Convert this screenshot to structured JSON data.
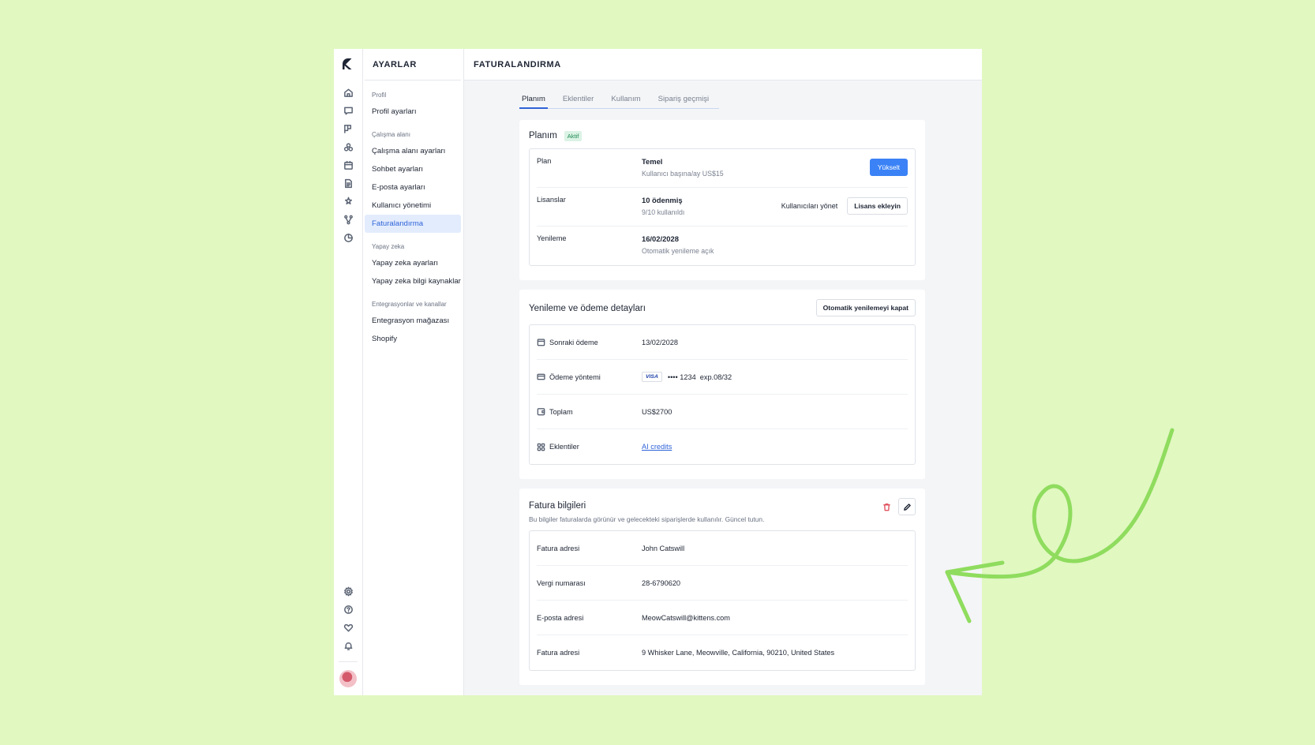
{
  "colors": {
    "accent": "#2e63d8",
    "primary_button": "#3b82f6",
    "background": "#e1f8c1",
    "badge_green": "#1f8a52",
    "arrow": "#8fdc5e"
  },
  "rail": {
    "icons": [
      "home-icon",
      "chat-icon",
      "kanban-icon",
      "contacts-icon",
      "calendar-icon",
      "document-icon",
      "automation-icon",
      "workflow-icon",
      "reports-icon"
    ],
    "bottom_icons": [
      "settings-icon",
      "help-icon",
      "heart-icon",
      "bell-icon"
    ]
  },
  "sidebar": {
    "title": "AYARLAR",
    "groups": [
      {
        "label": "Profil",
        "items": [
          {
            "label": "Profil ayarları"
          }
        ]
      },
      {
        "label": "Çalışma alanı",
        "items": [
          {
            "label": "Çalışma alanı ayarları"
          },
          {
            "label": "Sohbet ayarları"
          },
          {
            "label": "E-posta ayarları"
          },
          {
            "label": "Kullanıcı yönetimi"
          },
          {
            "label": "Faturalandırma"
          }
        ]
      },
      {
        "label": "Yapay zeka",
        "items": [
          {
            "label": "Yapay zeka ayarları"
          },
          {
            "label": "Yapay zeka bilgi kaynakları"
          }
        ]
      },
      {
        "label": "Entegrasyonlar ve kanallar",
        "items": [
          {
            "label": "Entegrasyon mağazası"
          },
          {
            "label": "Shopify"
          }
        ]
      }
    ]
  },
  "header": {
    "title": "FATURALANDIRMA"
  },
  "tabs": [
    {
      "label": "Planım"
    },
    {
      "label": "Eklentiler"
    },
    {
      "label": "Kullanım"
    },
    {
      "label": "Sipariş geçmişi"
    }
  ],
  "plan_card": {
    "title": "Planım",
    "badge": "Aktif",
    "rows": [
      {
        "label": "Plan",
        "value": "Temel",
        "sub": "Kullanıcı başına/ay US$15"
      },
      {
        "label": "Lisanslar",
        "value": "10 ödenmiş",
        "sub": "9/10 kullanıldı"
      },
      {
        "label": "Yenileme",
        "value": "16/02/2028",
        "sub": "Otomatik yenileme açık"
      }
    ],
    "upgrade_label": "Yükselt",
    "manage_users_label": "Kullanıcıları yönet",
    "add_license_label": "Lisans ekleyin"
  },
  "renewal_card": {
    "title": "Yenileme ve ödeme detayları",
    "button_label": "Otomatik yenilemeyi kapat",
    "rows": [
      {
        "label": "Sonraki ödeme",
        "value": "13/02/2028"
      },
      {
        "label": "Ödeme yöntemi",
        "card_brand": "VISA",
        "masked": "•••• 1234",
        "expiry": "exp.08/32"
      },
      {
        "label": "Toplam",
        "value": "US$2700"
      },
      {
        "label": "Eklentiler",
        "value": "AI credits"
      }
    ]
  },
  "billing_card": {
    "title": "Fatura bilgileri",
    "subtitle": "Bu bilgiler faturalarda görünür ve gelecekteki siparişlerde kullanılır. Güncel tutun.",
    "rows": [
      {
        "label": "Fatura adresi",
        "value": "John Catswill"
      },
      {
        "label": "Vergi numarası",
        "value": "28-6790620"
      },
      {
        "label": "E-posta adresi",
        "value": "MeowCatswill@kittens.com"
      },
      {
        "label": "Fatura adresi",
        "value": "9 Whisker Lane, Meowville, California, 90210, United States"
      }
    ]
  }
}
